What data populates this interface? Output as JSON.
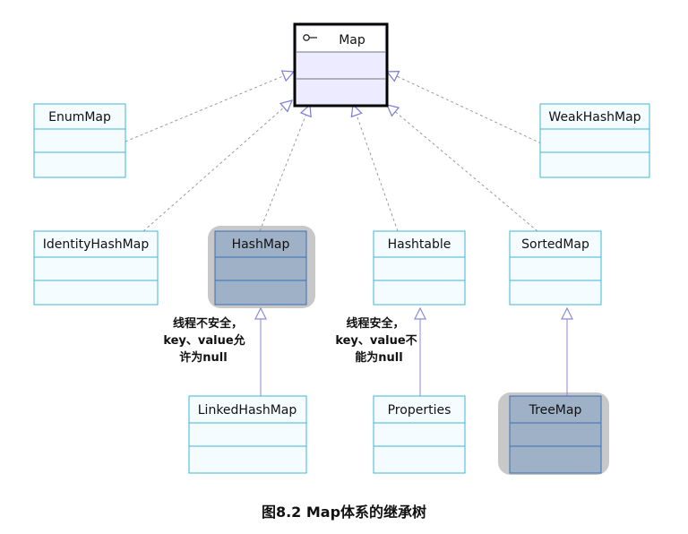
{
  "diagram": {
    "interface_symbol": "o-",
    "classes": {
      "map": "Map",
      "enummap": "EnumMap",
      "weakhashmap": "WeakHashMap",
      "identityhashmap": "IdentityHashMap",
      "hashmap": "HashMap",
      "hashtable": "Hashtable",
      "sortedmap": "SortedMap",
      "linkedhashmap": "LinkedHashMap",
      "properties": "Properties",
      "treemap": "TreeMap"
    },
    "notes": {
      "hashmap": [
        "线程不安全，",
        "key、value允",
        "许为null"
      ],
      "hashtable": [
        "线程安全，",
        "key、value不",
        "能为null"
      ]
    },
    "caption": "图8.2 Map体系的继承树",
    "colors": {
      "class_border": "#3fb6d6",
      "class_fill": "#f4fcff",
      "map_border": "#000000",
      "map_fill": "#e6e6fb",
      "highlight_shadow": "#c8c8c8",
      "highlight_fill": "#9fb1c7",
      "dashed_line": "#9a9a9a",
      "solid_line": "#7a7ad6"
    }
  }
}
